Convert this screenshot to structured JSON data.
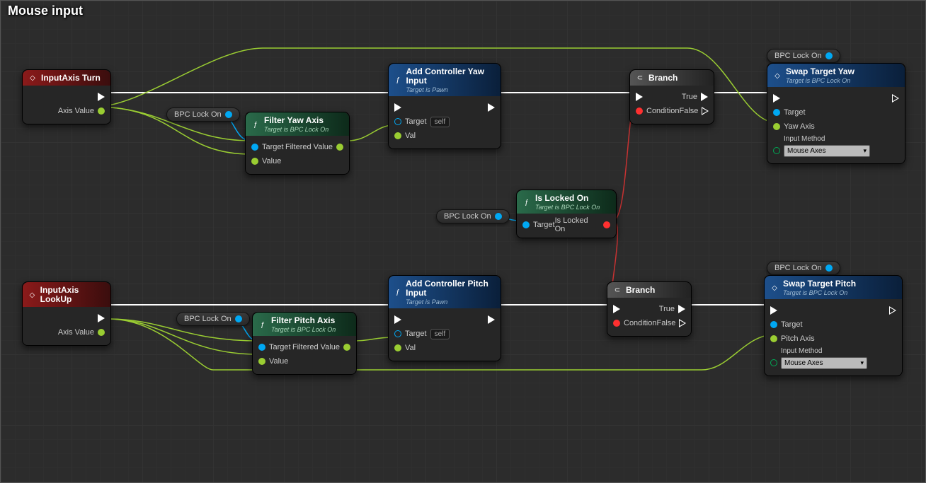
{
  "title": "Mouse input",
  "tags": {
    "bpc1": "BPC Lock On",
    "bpc2": "BPC Lock On",
    "bpc3": "BPC Lock On",
    "bpc4": "BPC Lock On",
    "bpc5": "BPC Lock On"
  },
  "nodes": {
    "inputTurn": {
      "title": "InputAxis Turn",
      "pin": "Axis Value"
    },
    "inputLookUp": {
      "title": "InputAxis LookUp",
      "pin": "Axis Value"
    },
    "filterYaw": {
      "title": "Filter Yaw Axis",
      "sub": "Target is BPC Lock On",
      "pTarget": "Target",
      "pValue": "Value",
      "pOut": "Filtered Value"
    },
    "filterPitch": {
      "title": "Filter Pitch Axis",
      "sub": "Target is BPC Lock On",
      "pTarget": "Target",
      "pValue": "Value",
      "pOut": "Filtered Value"
    },
    "addYaw": {
      "title": "Add Controller Yaw Input",
      "sub": "Target is Pawn",
      "pTarget": "Target",
      "pVal": "Val",
      "self": "self"
    },
    "addPitch": {
      "title": "Add Controller Pitch Input",
      "sub": "Target is Pawn",
      "pTarget": "Target",
      "pVal": "Val",
      "self": "self"
    },
    "isLocked": {
      "title": "Is Locked On",
      "sub": "Target is BPC Lock On",
      "pTarget": "Target",
      "pOut": "Is Locked On"
    },
    "branch1": {
      "title": "Branch",
      "pCond": "Condition",
      "pTrue": "True",
      "pFalse": "False"
    },
    "branch2": {
      "title": "Branch",
      "pCond": "Condition",
      "pTrue": "True",
      "pFalse": "False"
    },
    "swapYaw": {
      "title": "Swap Target Yaw",
      "sub": "Target is BPC Lock On",
      "pTarget": "Target",
      "pYaw": "Yaw Axis",
      "pMethod": "Input Method",
      "ddValue": "Mouse Axes"
    },
    "swapPitch": {
      "title": "Swap Target Pitch",
      "sub": "Target is BPC Lock On",
      "pTarget": "Target",
      "pPitch": "Pitch Axis",
      "pMethod": "Input Method",
      "ddValue": "Mouse Axes"
    }
  }
}
